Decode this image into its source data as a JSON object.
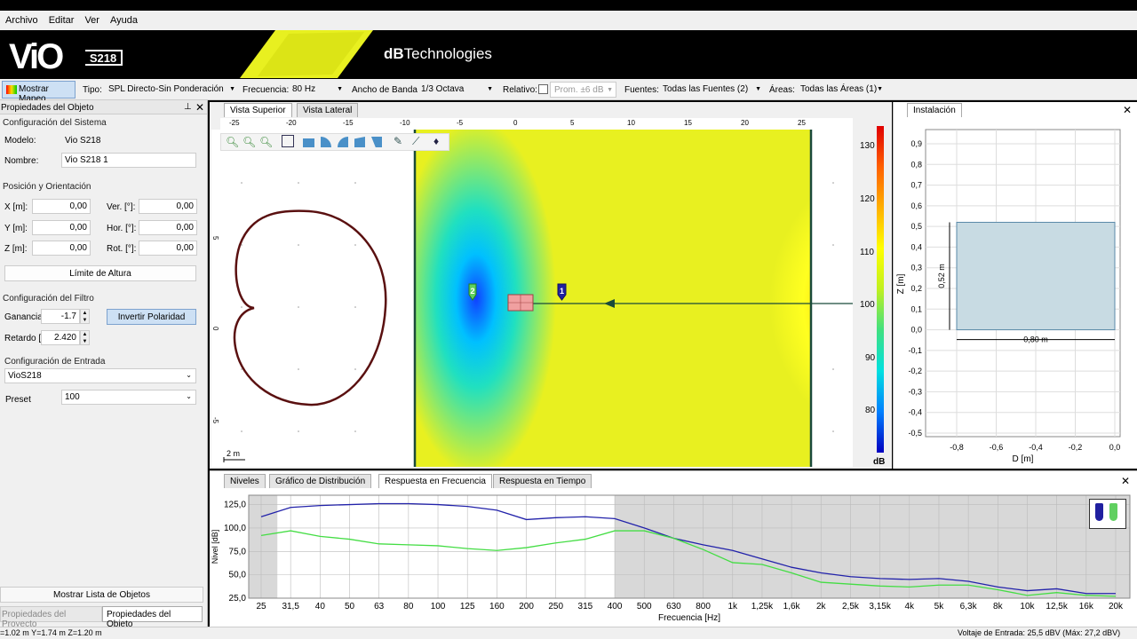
{
  "menu": [
    "Archivo",
    "Editar",
    "Ver",
    "Ayuda"
  ],
  "banner": {
    "logo": "ViO",
    "logo_sub": "S218",
    "brand_bold": "dB",
    "brand_rest": "Technologies"
  },
  "toolbar": {
    "mostrar_mapeo": "Mostrar Mapeo",
    "tipo_label": "Tipo:",
    "tipo_value": "SPL Directo-Sin Ponderación",
    "frecuencia_label": "Frecuencia:",
    "frecuencia_value": "80 Hz",
    "ancho_label": "Ancho de Banda:",
    "ancho_value": "1/3 Octava",
    "relativo_label": "Relativo:",
    "prom_value": "Prom. ±6 dB",
    "fuentes_label": "Fuentes:",
    "fuentes_value": "Todas las Fuentes (2)",
    "areas_label": "Áreas:",
    "areas_value": "Todas las Áreas (1)"
  },
  "left": {
    "title": "Propiedades del Objeto",
    "sistema": "Configuración del Sistema",
    "modelo_label": "Modelo:",
    "modelo_value": "Vio S218",
    "nombre_label": "Nombre:",
    "nombre_value": "Vio S218 1",
    "posicion": "Posición y Orientación",
    "x_label": "X [m]:",
    "x_value": "0,00",
    "y_label": "Y [m]:",
    "y_value": "0,00",
    "z_label": "Z [m]:",
    "z_value": "0,00",
    "ver_label": "Ver. [°]:",
    "ver_value": "0,00",
    "hor_label": "Hor. [°]:",
    "hor_value": "0,00",
    "rot_label": "Rot. [°]:",
    "rot_value": "0,00",
    "limite": "Límite de Altura",
    "filtro": "Configuración del Filtro",
    "ganancia_label": "Ganancia",
    "ganancia_value": "-1.7",
    "invertir": "Invertir Polaridad",
    "retardo_label": "Retardo [r",
    "retardo_value": "2.420",
    "entrada": "Configuración de Entrada",
    "entrada_value": "VioS218",
    "preset_label": "Preset",
    "preset_value": "100",
    "mostrar_lista": "Mostrar Lista de Objetos",
    "tab_proyecto": "Propiedades del Proyecto",
    "tab_objeto": "Propiedades del Objeto"
  },
  "main": {
    "tab_superior": "Vista Superior",
    "tab_lateral": "Vista Lateral",
    "scale": "2 m",
    "hticks": [
      "-25",
      "-20",
      "-15",
      "-10",
      "-5",
      "0",
      "5",
      "10",
      "15",
      "20",
      "25"
    ],
    "vticks": [
      "5",
      "0",
      "-5",
      "-10"
    ],
    "colorbar_ticks": [
      "130",
      "120",
      "110",
      "100",
      "90",
      "80"
    ],
    "colorbar_unit": "dB",
    "source1": "1",
    "source2": "2"
  },
  "install": {
    "tab": "Instalación",
    "yticks": [
      "0,9",
      "0,8",
      "0,7",
      "0,6",
      "0,5",
      "0,4",
      "0,3",
      "0,2",
      "0,1",
      "0,0",
      "-0,1",
      "-0,2",
      "-0,3",
      "-0,4",
      "-0,5"
    ],
    "xticks": [
      "-0,8",
      "-0,6",
      "-0,4",
      "-0,2",
      "0,0"
    ],
    "xlabel": "D [m]",
    "ylabel": "Z [m]",
    "width_label": "0,80 m",
    "height_label": "0,52 m"
  },
  "bottom": {
    "tabs": [
      "Niveles",
      "Gráfico de Distribución",
      "Respuesta en Frecuencia",
      "Respuesta en Tiempo"
    ],
    "ylabel": "Nivel [dB]",
    "xlabel": "Frecuencia [Hz]"
  },
  "chart_data": {
    "type": "line",
    "xlabel": "Frecuencia [Hz]",
    "ylabel": "Nivel [dB]",
    "ylim": [
      25,
      135
    ],
    "yticks": [
      "125,0",
      "100,0",
      "75,0",
      "50,0",
      "25,0"
    ],
    "categories": [
      "25",
      "31,5",
      "40",
      "50",
      "63",
      "80",
      "100",
      "125",
      "160",
      "200",
      "250",
      "315",
      "400",
      "500",
      "630",
      "800",
      "1k",
      "1,25k",
      "1,6k",
      "2k",
      "2,5k",
      "3,15k",
      "4k",
      "5k",
      "6,3k",
      "8k",
      "10k",
      "12,5k",
      "16k",
      "20k"
    ],
    "series": [
      {
        "color": "#2222aa",
        "values": [
          112,
          122,
          124,
          125,
          126,
          126,
          125,
          123,
          119,
          109,
          111,
          112,
          110,
          100,
          89,
          82,
          76,
          67,
          58,
          52,
          48,
          46,
          45,
          46,
          43,
          37,
          33,
          35,
          30,
          30
        ]
      },
      {
        "color": "#44dd44",
        "values": [
          92,
          97,
          91,
          88,
          83,
          82,
          81,
          78,
          76,
          79,
          84,
          88,
          97,
          97,
          89,
          77,
          63,
          61,
          52,
          42,
          40,
          38,
          37,
          39,
          39,
          34,
          28,
          31,
          28,
          27
        ]
      }
    ]
  },
  "status": {
    "coords": "=1.02 m Y=1.74 m Z=1.20 m",
    "voltaje": "Voltaje de Entrada: 25,5 dBV (Máx: 27,2 dBV)"
  },
  "colors": {
    "accent": "#cde0f4",
    "brand_yellow": "#e8f020"
  }
}
